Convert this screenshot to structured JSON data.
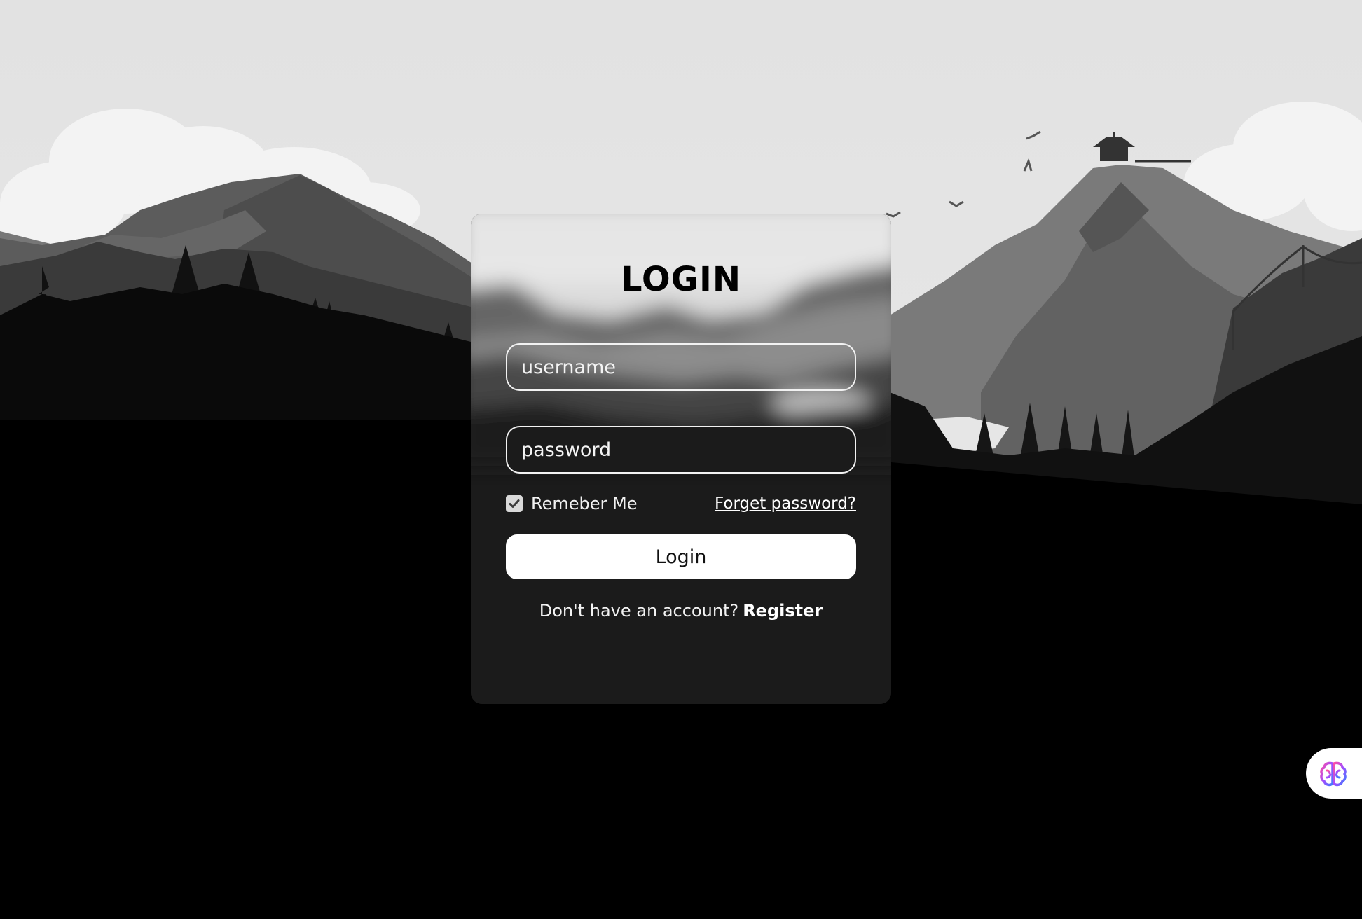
{
  "login_form": {
    "title": "LOGIN",
    "username_placeholder": "username",
    "password_placeholder": "password",
    "remember_me_label": "Remeber Me",
    "remember_me_checked": true,
    "forgot_password_link": "Forget password?",
    "login_button_label": "Login",
    "no_account_text": "Don't have an account?",
    "register_link": "Register"
  },
  "assistant_widget": {
    "icon": "brain-icon"
  },
  "colors": {
    "card_background": "#1b1b1b",
    "button_background": "#ffffff",
    "page_background": "#000000"
  }
}
